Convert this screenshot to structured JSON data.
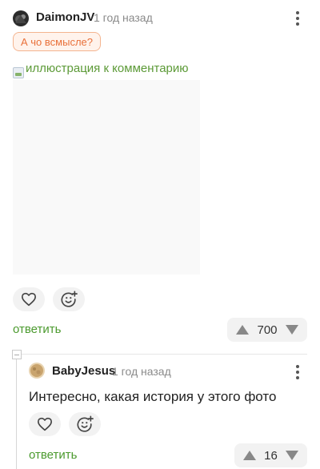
{
  "comment1": {
    "author": "DaimonJV",
    "time": "1 год назад",
    "reply_to": "А чо всмысле?",
    "image_alt": "иллюстрация к комментарию",
    "reply_label": "ответить",
    "rating": "700"
  },
  "comment2": {
    "author": "BabyJesus",
    "time": "1 год назад",
    "text": "Интересно, какая история у этого фото",
    "reply_label": "ответить",
    "rating": "16"
  },
  "colors": {
    "accent_green": "#4b9a2e",
    "reply_tag_text": "#e9713a",
    "reply_tag_border": "#f4b48f"
  },
  "icons": [
    "avatar-daimonjv",
    "kebab-menu-icon",
    "heart-icon",
    "emoji-add-icon",
    "upvote-icon",
    "downvote-icon",
    "avatar-babyjesus",
    "collapse-icon"
  ]
}
